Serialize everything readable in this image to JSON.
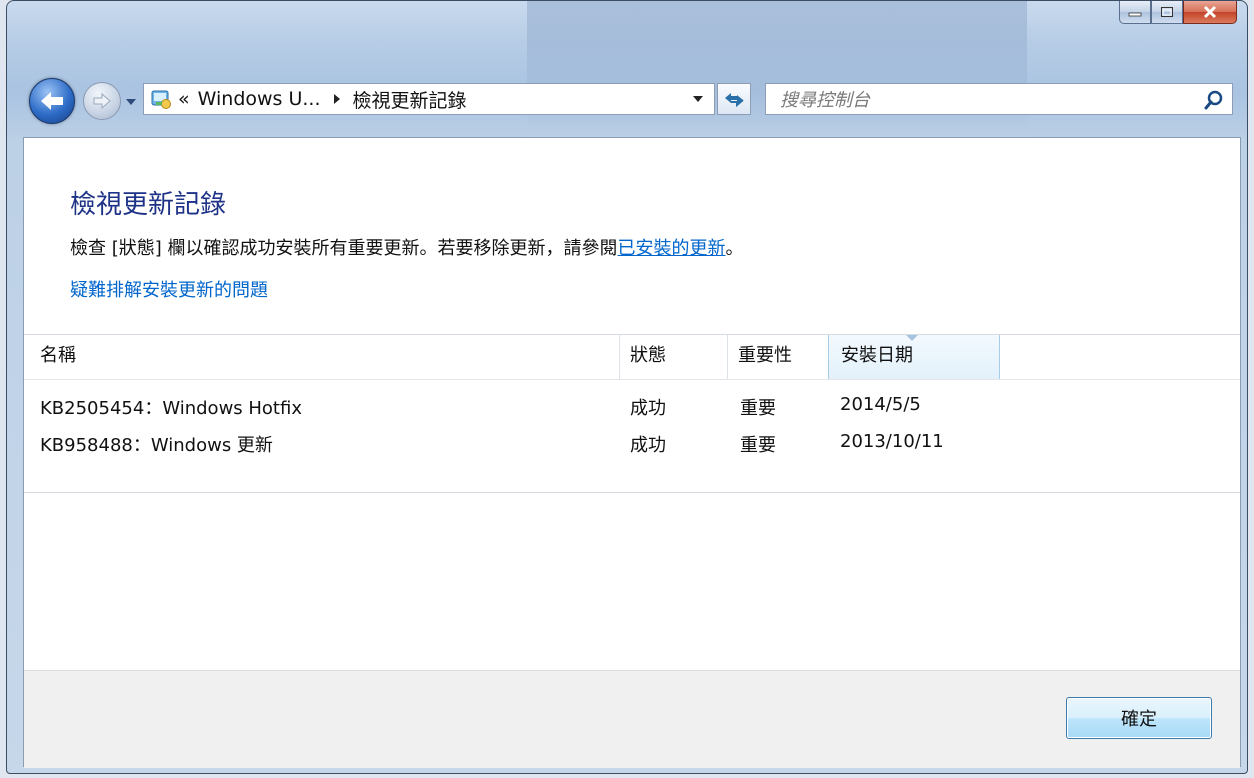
{
  "window": {
    "caption_buttons": [
      "minimize-icon",
      "maximize-icon",
      "close-icon"
    ]
  },
  "nav": {
    "breadcrumb_prefix": "«",
    "breadcrumb_parent": "Windows U...",
    "breadcrumb_current": "檢視更新記錄",
    "search_placeholder": "搜尋控制台"
  },
  "page": {
    "title": "檢視更新記錄",
    "instruction_text": "檢查 [狀態] 欄以確認成功安裝所有重要更新。若要移除更新，請參閱",
    "instruction_link": "已安裝的更新",
    "instruction_end": "。",
    "troubleshoot_link": "疑難排解安裝更新的問題"
  },
  "table": {
    "columns": [
      "名稱",
      "狀態",
      "重要性",
      "安裝日期"
    ],
    "sorted_column": "安裝日期",
    "rows": [
      {
        "name": "KB2505454：Windows Hotfix",
        "status": "成功",
        "importance": "重要",
        "date": "2014/5/5"
      },
      {
        "name": "KB958488：Windows 更新",
        "status": "成功",
        "importance": "重要",
        "date": "2013/10/11"
      }
    ]
  },
  "footer": {
    "ok_label": "確定"
  },
  "colors": {
    "title_blue": "#1e3287",
    "link_blue": "#0066cc",
    "window_frame": "#b7cde6"
  }
}
